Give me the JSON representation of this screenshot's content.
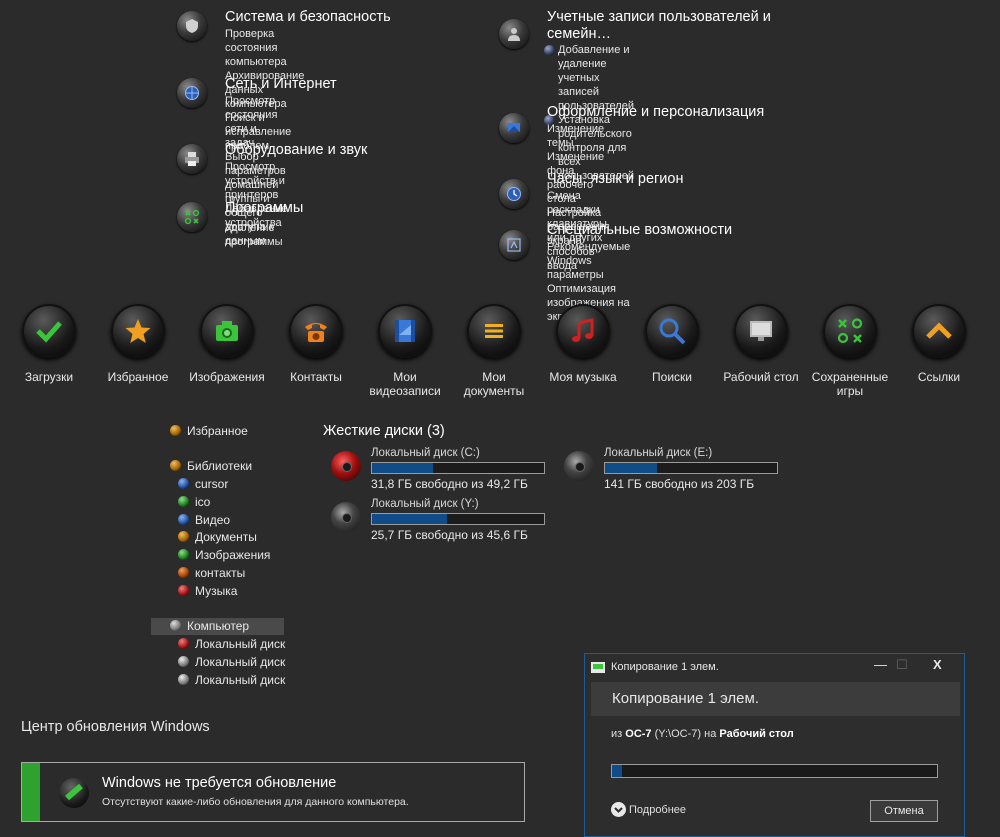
{
  "control_panel": {
    "left": [
      {
        "title": "Система и безопасность",
        "icon": "shield-icon",
        "links": [
          "Проверка состояния компьютера",
          "Архивирование данных компьютера",
          "Поиск и исправление проблем"
        ]
      },
      {
        "title": "Сеть и Интернет",
        "icon": "globe-icon",
        "links": [
          "Просмотр состояния сети и задач",
          "Выбор параметров домашней группы и общего",
          "доступа к данным"
        ]
      },
      {
        "title": "Оборудование и звук",
        "icon": "printer-icon",
        "links": [
          "Просмотр устройств и принтеров",
          "Добавление устройства"
        ]
      },
      {
        "title": "Программы",
        "icon": "programs-icon",
        "links": [
          "Удаление программы"
        ]
      }
    ],
    "right": [
      {
        "title": "Учетные записи пользователей и",
        "title2": "семейн…",
        "icon": "users-icon",
        "links": [
          "Добавление и удаление учетных записей",
          "пользователей",
          "Установка родительского контроля для всех",
          "пользователей"
        ]
      },
      {
        "title": "Оформление и персонализация",
        "icon": "paint-icon",
        "links": [
          "Изменение темы",
          "Изменение фона рабочего стола",
          "Настройка разрешения экрана"
        ]
      },
      {
        "title": "Часы, язык и регион",
        "icon": "clock-globe-icon",
        "links": [
          "Смена раскладки клавиатуры или других способов",
          "ввода"
        ]
      },
      {
        "title": "Специальные возможности",
        "icon": "accessibility-icon",
        "links": [
          "Рекомендуемые Windows параметры",
          "Оптимизация изображения на экране"
        ]
      }
    ]
  },
  "folders": [
    {
      "label": "Загрузки",
      "label2": "",
      "icon": "download-check-icon",
      "color": "#3cc43c"
    },
    {
      "label": "Избранное",
      "label2": "",
      "icon": "star-icon",
      "color": "#f0a020"
    },
    {
      "label": "Изображения",
      "label2": "",
      "icon": "camera-icon",
      "color": "#3cc43c"
    },
    {
      "label": "Контакты",
      "label2": "",
      "icon": "phone-icon",
      "color": "#f08020"
    },
    {
      "label": "Мои",
      "label2": "видеозаписи",
      "icon": "film-icon",
      "color": "#3a78d8"
    },
    {
      "label": "Мои",
      "label2": "документы",
      "icon": "document-icon",
      "color": "#f0b020"
    },
    {
      "label": "Моя музыка",
      "label2": "",
      "icon": "music-icon",
      "color": "#d02020"
    },
    {
      "label": "Поиски",
      "label2": "",
      "icon": "magnifier-icon",
      "color": "#3a78d8"
    },
    {
      "label": "Рабочий стол",
      "label2": "",
      "icon": "monitor-icon",
      "color": "#bbbbbb"
    },
    {
      "label": "Сохраненные",
      "label2": "игры",
      "icon": "games-icon",
      "color": "#3cc43c"
    },
    {
      "label": "Ссылки",
      "label2": "",
      "icon": "link-chevron-icon",
      "color": "#f0a020"
    }
  ],
  "nav": {
    "favorites": "Избранное",
    "libraries": "Библиотеки",
    "library_items": [
      "cursor",
      "ico",
      "Видео",
      "Документы",
      "Изображения",
      "контакты",
      "Музыка"
    ],
    "library_colors": [
      "#3a78d8",
      "#3cc43c",
      "#3a78d8",
      "#f0a020",
      "#3cc43c",
      "#f08020",
      "#d02020"
    ],
    "computer": "Компьютер",
    "drives": [
      "Локальный диск",
      "Локальный диск",
      "Локальный диск"
    ],
    "drive_colors": [
      "#d02020",
      "#bbbbbb",
      "#bbbbbb"
    ]
  },
  "disks": {
    "heading": "Жесткие диски (3)",
    "items": [
      {
        "name": "Локальный диск (C:)",
        "free": "31,8 ГБ свободно из 49,2 ГБ",
        "used_fraction": 0.354
      },
      {
        "name": "Локальный диск (E:)",
        "free": "141 ГБ свободно из 203 ГБ",
        "used_fraction": 0.305
      },
      {
        "name": "Локальный диск (Y:)",
        "free": "25,7 ГБ свободно из 45,6 ГБ",
        "used_fraction": 0.436
      }
    ]
  },
  "update": {
    "title": "Центр обновления Windows",
    "status": "Windows не требуется обновление",
    "detail": "Отсутствуют какие-либо обновления для данного компьютера."
  },
  "dialog": {
    "title": "Копирование 1 элем.",
    "heading": "Копирование 1 элем.",
    "from_word": "из",
    "source": "ОС-7",
    "source_path": "(Y:\\ОС-7)",
    "to_word": "на",
    "dest": "Рабочий стол",
    "progress_fraction": 0.03,
    "more": "Подробнее",
    "cancel": "Отмена",
    "minimize": "—",
    "maximize": "☐",
    "close": "X"
  }
}
